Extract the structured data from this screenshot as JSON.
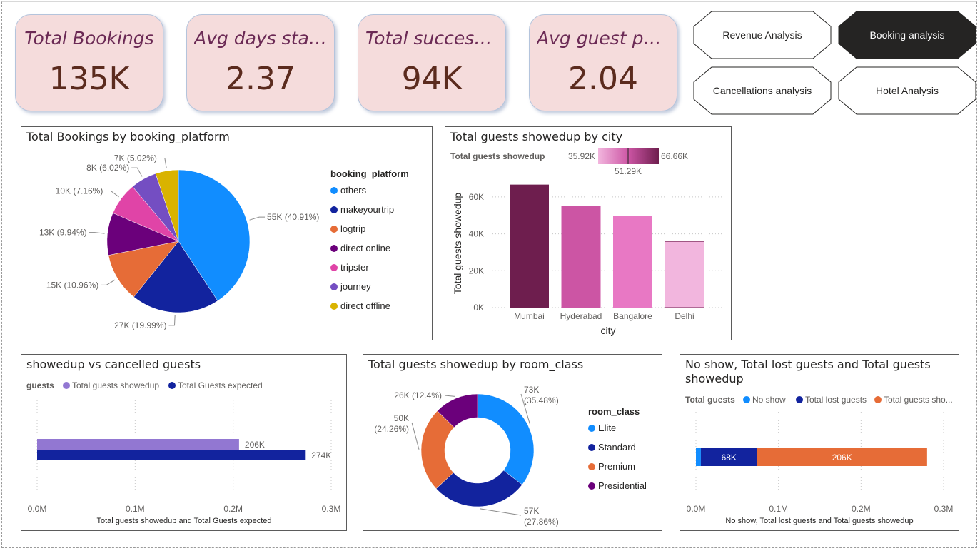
{
  "kpis": [
    {
      "title": "Total Bookings",
      "value": "135K"
    },
    {
      "title": "Avg days stayed",
      "value": "2.37"
    },
    {
      "title": "Total successful...",
      "value": "94K"
    },
    {
      "title": "Avg guest per...",
      "value": "2.04"
    }
  ],
  "nav": [
    {
      "label": "Revenue Analysis",
      "active": false
    },
    {
      "label": "Booking analysis",
      "active": true
    },
    {
      "label": "Cancellations analysis",
      "active": false
    },
    {
      "label": "Hotel Analysis",
      "active": false
    }
  ],
  "panels": {
    "bookings_by_platform": "Total Bookings by booking_platform",
    "guests_by_city": "Total guests showedup by city",
    "showedup_vs_cancelled": "showedup vs cancelled guests",
    "guests_by_room_class": "Total guests showedup by room_class",
    "no_show_lost": "No show, Total lost guests and Total guests showedup"
  },
  "chart_data": [
    {
      "type": "pie",
      "title": "Total Bookings by booking_platform",
      "legend_title": "booking_platform",
      "legend_position": "right",
      "slices": [
        {
          "name": "others",
          "value": 55,
          "label": "55K (40.91%)",
          "color": "#118DFF"
        },
        {
          "name": "makeyourtrip",
          "value": 27,
          "label": "27K (19.99%)",
          "color": "#12239E"
        },
        {
          "name": "logtrip",
          "value": 15,
          "label": "15K (10.96%)",
          "color": "#E66C37"
        },
        {
          "name": "direct online",
          "value": 13,
          "label": "13K (9.94%)",
          "color": "#6B007B"
        },
        {
          "name": "tripster",
          "value": 10,
          "label": "10K (7.16%)",
          "color": "#E044A7"
        },
        {
          "name": "journey",
          "value": 8,
          "label": "8K (6.02%)",
          "color": "#744EC2"
        },
        {
          "name": "direct offline",
          "value": 7,
          "label": "7K (5.02%)",
          "color": "#D9B300"
        }
      ]
    },
    {
      "type": "bar",
      "title": "Total guests showedup by city",
      "xlabel": "city",
      "ylabel": "Total guests showedup",
      "categories": [
        "Mumbai",
        "Hyderabad",
        "Bangalore",
        "Delhi"
      ],
      "values": [
        66.66,
        55.0,
        49.5,
        35.92
      ],
      "colors": [
        "#6E1E4E",
        "#CC55A4",
        "#E878C4",
        "#F2B6DE"
      ],
      "yticks": [
        "0K",
        "20K",
        "40K",
        "60K"
      ],
      "ylim": [
        0,
        70
      ],
      "gradient_legend": {
        "title": "Total guests showedup",
        "min": "35.92K",
        "mid": "51.29K",
        "max": "66.66K"
      }
    },
    {
      "type": "bar",
      "orientation": "horizontal",
      "title": "showedup vs cancelled guests",
      "legend_title": "guests",
      "legend_position": "top",
      "series": [
        {
          "name": "Total guests showedup",
          "value": 206,
          "label": "206K",
          "color": "#9277D2"
        },
        {
          "name": "Total Guests expected",
          "value": 274,
          "label": "274K",
          "color": "#12239E"
        }
      ],
      "xticks": [
        "0.0M",
        "0.1M",
        "0.2M",
        "0.3M"
      ],
      "xlim": [
        0,
        300
      ],
      "xlabel": "Total guests showedup and Total Guests expected"
    },
    {
      "type": "pie",
      "donut": true,
      "title": "Total guests showedup by room_class",
      "legend_title": "room_class",
      "legend_position": "right",
      "slices": [
        {
          "name": "Elite",
          "value": 73,
          "label": "73K (35.48%)",
          "color": "#118DFF"
        },
        {
          "name": "Standard",
          "value": 57,
          "label": "57K (27.86%)",
          "color": "#12239E"
        },
        {
          "name": "Premium",
          "value": 50,
          "label": "50K (24.26%)",
          "color": "#E66C37"
        },
        {
          "name": "Presidential",
          "value": 26,
          "label": "26K (12.4%)",
          "color": "#6B007B"
        }
      ]
    },
    {
      "type": "bar",
      "orientation": "horizontal",
      "stacked": true,
      "title": "No show, Total lost guests and Total guests showedup",
      "legend_title": "Total guests",
      "legend_position": "top",
      "series": [
        {
          "name": "No show",
          "value": 6,
          "label": "",
          "color": "#118DFF"
        },
        {
          "name": "Total lost guests",
          "value": 68,
          "label": "68K",
          "color": "#12239E"
        },
        {
          "name": "Total guests sho...",
          "value": 206,
          "label": "206K",
          "color": "#E66C37"
        }
      ],
      "xticks": [
        "0.0M",
        "0.1M",
        "0.2M",
        "0.3M"
      ],
      "xlim": [
        0,
        300
      ],
      "xlabel": "No show, Total lost guests and Total guests showedup"
    }
  ]
}
